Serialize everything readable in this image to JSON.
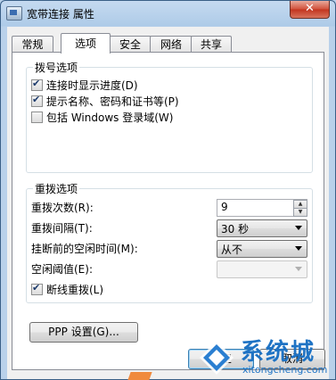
{
  "window": {
    "title": "宽带连接 属性",
    "close_glyph": "✕"
  },
  "tabs": [
    {
      "label": "常规",
      "active": false
    },
    {
      "label": "选项",
      "active": true
    },
    {
      "label": "安全",
      "active": false
    },
    {
      "label": "网络",
      "active": false
    },
    {
      "label": "共享",
      "active": false
    }
  ],
  "dial_options": {
    "title": "拨号选项",
    "items": [
      {
        "label": "连接时显示进度(D)",
        "checked": true
      },
      {
        "label": "提示名称、密码和证书等(P)",
        "checked": true
      },
      {
        "label": "包括 Windows 登录域(W)",
        "checked": false
      }
    ]
  },
  "redial_options": {
    "title": "重拨选项",
    "redial_attempts": {
      "label": "重拨次数(R):",
      "value": "9"
    },
    "redial_interval": {
      "label": "重拨间隔(T):",
      "value": "30 秒"
    },
    "idle_time": {
      "label": "挂断前的空闲时间(M):",
      "value": "从不"
    },
    "idle_threshold": {
      "label": "空闲阈值(E):",
      "value": ""
    },
    "redial_on_drop": {
      "label": "断线重拨(L)",
      "checked": true
    }
  },
  "ppp_button": "PPP 设置(G)...",
  "footer": {
    "ok_label": "确定",
    "cancel_label": "取消"
  },
  "watermark": {
    "text": "系统城",
    "sub": "xitongcheng.com"
  }
}
